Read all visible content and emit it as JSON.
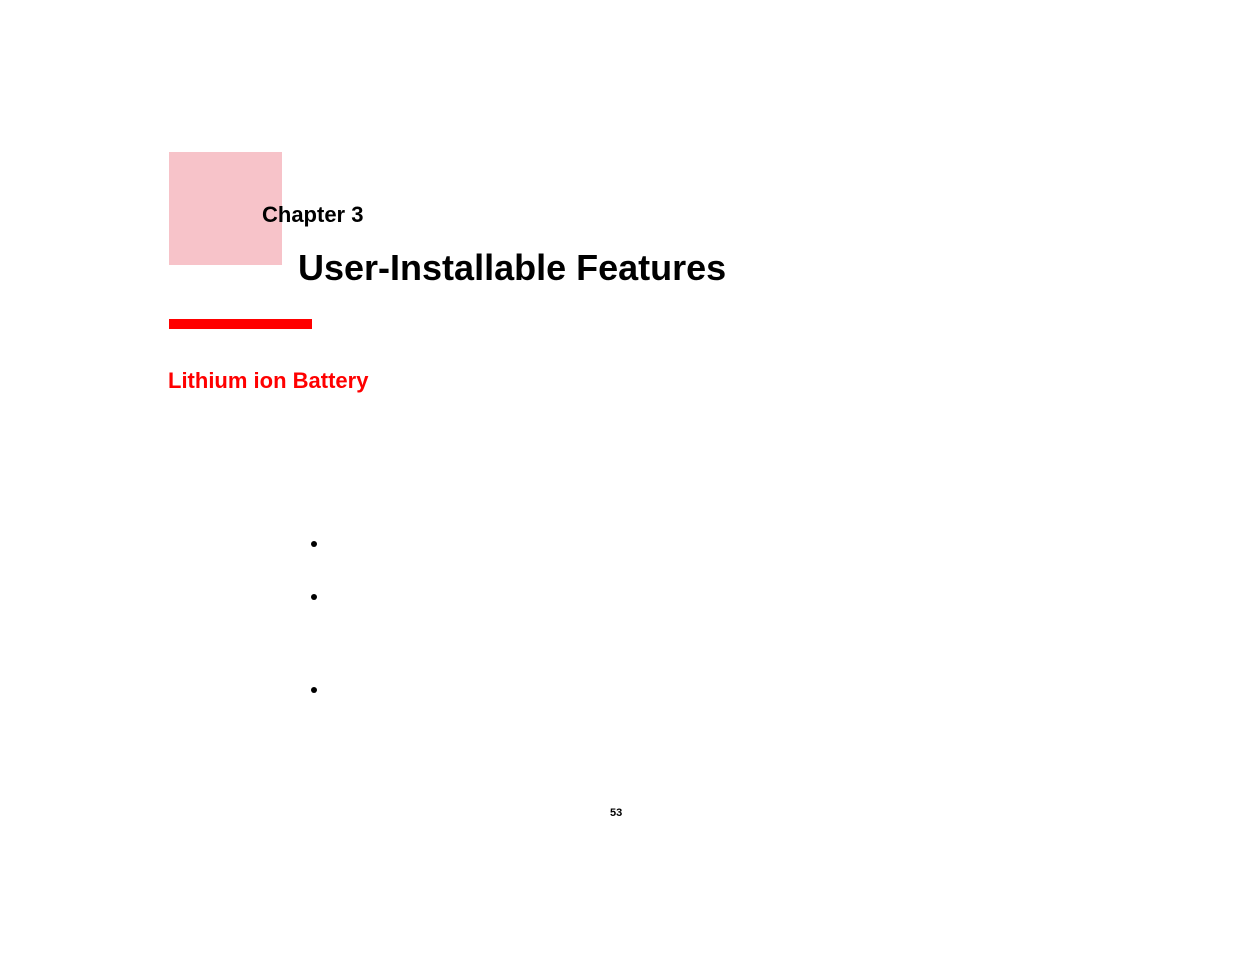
{
  "chapter": {
    "label": "Chapter 3",
    "title": "User-Installable Features"
  },
  "section": {
    "heading": "Lithium ion Battery"
  },
  "page": {
    "number": "53"
  }
}
